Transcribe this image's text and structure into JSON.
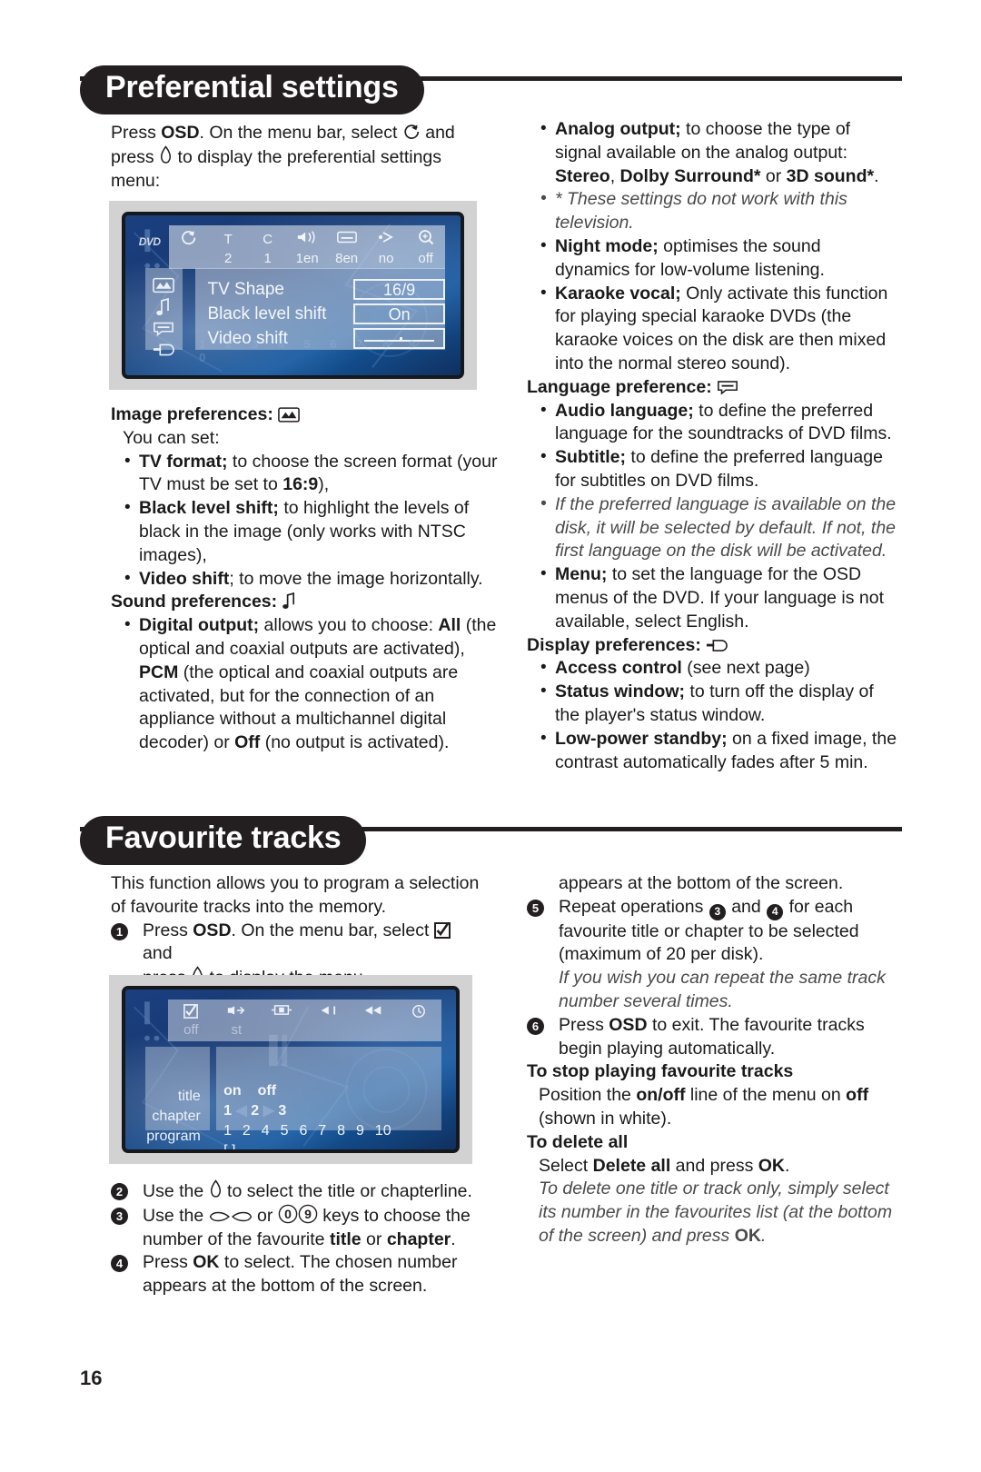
{
  "page": {
    "number": "16"
  },
  "sections": [
    {
      "id": "preferential",
      "title": "Preferential settings"
    },
    {
      "id": "favourite",
      "title": "Favourite tracks"
    }
  ],
  "preferential": {
    "intro": {
      "l1_a": "Press ",
      "l1_osd": "OSD",
      "l1_b": ". On the menu bar, select ",
      "l1_c": " and",
      "l2_a": "press ",
      "l2_b": " to display the preferential settings",
      "l3": "menu:"
    },
    "screen": {
      "dvd_tag": "DVD",
      "menubar_values": [
        "",
        "2",
        "1",
        "1en",
        "8en",
        "no",
        "off"
      ],
      "menubar_icons": [
        "preferences-icon",
        "title-icon",
        "chapter-icon",
        "audio-icon",
        "subtitle-icon",
        "angle-icon",
        "zoom-icon"
      ],
      "sidebar_icons": [
        "image-preferences-icon",
        "sound-preferences-icon",
        "language-preferences-icon",
        "display-preferences-icon"
      ],
      "rows": [
        {
          "label": "TV Shape",
          "value": "16/9"
        },
        {
          "label": "Black level shift",
          "value": "On"
        },
        {
          "label": "Video shift",
          "value": ""
        }
      ],
      "ghost_digits": "1 2 3 4 5 6 7 8 9 0"
    },
    "image_preferences": {
      "heading": "Image preferences:",
      "you_can_set": "You can set:",
      "items": [
        {
          "term": "TV format;",
          "rest": " to choose the screen format (your TV must be set to ",
          "bold_tail": "16:9",
          "tail": "),"
        },
        {
          "term": "Black level shift;",
          "rest": " to highlight the levels of black in the image (only works with NTSC images),"
        },
        {
          "term": "Video shift",
          "rest": "; to move the image horizontally."
        }
      ]
    },
    "sound_preferences": {
      "heading": "Sound preferences:",
      "items": [
        {
          "term": "Digital output;",
          "p1": " allows you to choose: ",
          "b1": "All",
          "p2": " (the optical and coaxial outputs are activated), ",
          "b2": "PCM",
          "p3": " (the optical and coaxial outputs are activated, but for the connection of an appliance without a multichannel digital decoder) or ",
          "b3": "Off",
          "p4": " (no output is activated)."
        }
      ]
    },
    "right_items": [
      {
        "term": "Analog output;",
        "p1": " to choose the type of signal available on the analog output: ",
        "b1": "Stereo",
        "p2": ", ",
        "b2": "Dolby Surround*",
        "p3": " or ",
        "b3": "3D sound*",
        "p4": ".",
        "note": "* These settings do not work with this television."
      },
      {
        "term": "Night mode;",
        "p1": " optimises the sound dynamics for low-volume listening."
      },
      {
        "term": "Karaoke vocal;",
        "p1": " Only activate this function for playing special karaoke DVDs (the karaoke voices on the disk are then mixed into the normal stereo sound)."
      }
    ],
    "language_preference": {
      "heading": "Language preference:",
      "items": [
        {
          "term": "Audio language;",
          "p1": " to define the preferred language for the soundtracks of DVD films."
        },
        {
          "term": "Subtitle;",
          "p1": " to define the preferred language for subtitles on DVD films.",
          "note": "If the preferred language is available on the disk, it will be selected by default. If not, the first language on the disk will be activated."
        },
        {
          "term": "Menu;",
          "p1": " to set the language for the OSD menus of the DVD. If your language is not available, select English."
        }
      ]
    },
    "display_preferences": {
      "heading": "Display preferences:",
      "items": [
        {
          "term": "Access control",
          "p1": " (see next page)"
        },
        {
          "term": "Status window;",
          "p1": " to turn off the display of the player's status window."
        },
        {
          "term": "Low-power standby;",
          "p1": " on a fixed image, the contrast automatically fades after 5 min."
        }
      ]
    }
  },
  "favourite": {
    "intro": "This function allows you to program a selection of favourite tracks into the memory.",
    "step1": {
      "num": "1",
      "a": "Press ",
      "osd": "OSD",
      "b": ". On the menu bar, select ",
      "c": " and",
      "d": "press ",
      "e": " to display the menu."
    },
    "screen": {
      "menubar_icons": [
        "favourite-tracks-icon",
        "shuffle-icon",
        "repeat-ab-icon",
        "scan-icon",
        "repeat-icon",
        "time-icon"
      ],
      "menubar_values": [
        "off",
        "st",
        "",
        "",
        "",
        ""
      ],
      "left_labels": [
        "title",
        "chapter",
        "program"
      ],
      "onoff": [
        "on",
        "off"
      ],
      "title_row": [
        "1",
        "2",
        "3"
      ],
      "chapter_row": [
        "1",
        "2",
        "4",
        "5",
        "6",
        "7",
        "8",
        "9",
        "10"
      ],
      "program_row": "[ ]"
    },
    "steps": [
      {
        "num": "2",
        "a": "Use the ",
        "icon": "cursor-down-icon",
        "b": " to select the title or chapterline."
      },
      {
        "num": "3",
        "a": "Use the ",
        "icon1": "cursor-left-right-icon",
        "b": " or ",
        "key0": "0",
        "key9": "9",
        "c": " keys to choose the number of the favourite ",
        "bold1": "title",
        "d": " or ",
        "bold2": "chapter",
        "e": "."
      },
      {
        "num": "4",
        "a": "Press ",
        "ok": "OK",
        "b": " to select. The chosen number appears at the bottom of the screen."
      },
      {
        "num": "5",
        "a": "Repeat operations ",
        "n1": "3",
        "b": " and ",
        "n2": "4",
        "c": " for each favourite title or chapter to be selected (maximum of 20 per disk).",
        "note": "If you wish you can repeat the same track number several times."
      },
      {
        "num": "6",
        "a": "Press ",
        "osd": "OSD",
        "b": " to exit. The favourite tracks begin playing automatically."
      }
    ],
    "stop": {
      "heading": "To stop playing favourite tracks",
      "a": "Position the ",
      "b1": "on/off",
      "b": " line of the menu on ",
      "b2": "off",
      "c": " (shown in white)."
    },
    "delete": {
      "heading": "To delete all",
      "a": "Select ",
      "b1": "Delete all",
      "b": " and press ",
      "b2": "OK",
      "c": ".",
      "note1": "To delete one title or track only, simply select its number in the favourites list (at the bottom of the screen) and press ",
      "note_ok": "OK",
      "note2": "."
    }
  },
  "colors": {
    "ink": "#231f20",
    "screen_blue": "#14407e",
    "figure_bg": "#d2d2d2"
  }
}
